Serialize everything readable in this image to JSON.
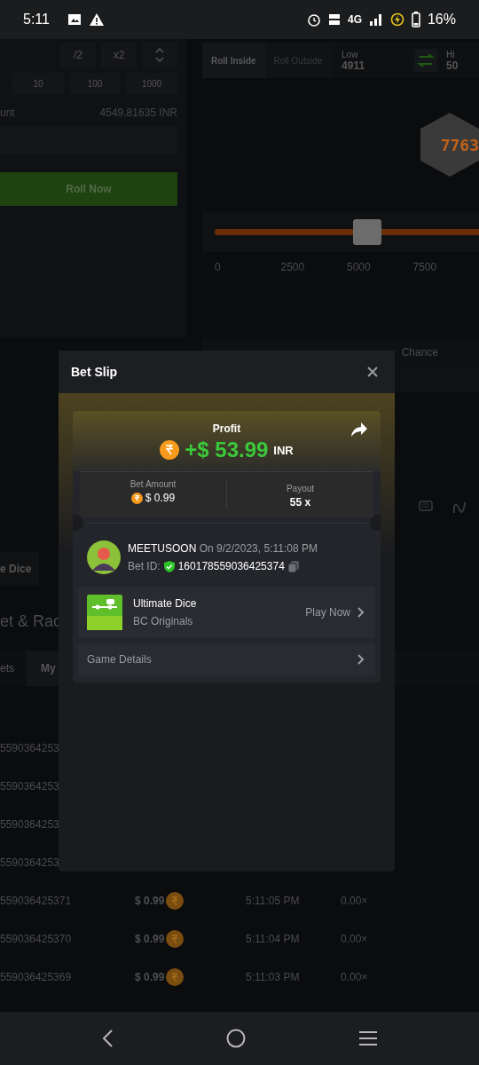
{
  "status_bar": {
    "time": "5:11",
    "network": "4G",
    "battery": "16%"
  },
  "bet_controls": {
    "half": "/2",
    "double": "x2",
    "presets": [
      "10",
      "100",
      "1000"
    ],
    "amount_label": "unt",
    "balance": "4549.81635 INR",
    "roll_button": "Roll Now"
  },
  "roll_panel": {
    "modes": [
      {
        "label": "Roll Inside",
        "selected": true
      },
      {
        "label": "Roll Outside",
        "selected": false
      }
    ],
    "low_label": "Low",
    "low_value": "4911",
    "high_label": "Hi",
    "high_value": "50",
    "result": "7763",
    "slider": {
      "level": 0.49
    },
    "scale": [
      "0",
      "2500",
      "5000",
      "7500"
    ],
    "chance_label": "Chance"
  },
  "lower": {
    "game_chip": "e Dice",
    "section_title": "et & Rac",
    "tabs": [
      {
        "label": "ets",
        "selected": false
      },
      {
        "label": "My",
        "selected": true
      }
    ],
    "rows": [
      {
        "bet_id": "5590364253"
      },
      {
        "bet_id": "5590364253"
      },
      {
        "bet_id": "5590364253"
      },
      {
        "bet_id": "5590364253"
      },
      {
        "bet_id": "559036425371",
        "amount": "$ 0.99",
        "time": "5:11:05 PM",
        "payout": "0.00×"
      },
      {
        "bet_id": "559036425370",
        "amount": "$ 0.99",
        "time": "5:11:04 PM",
        "payout": "0.00×"
      },
      {
        "bet_id": "559036425369",
        "amount": "$ 0.99",
        "time": "5:11:03 PM",
        "payout": "0.00×"
      }
    ]
  },
  "bet_slip": {
    "title": "Bet Slip",
    "profit_label": "Profit",
    "profit": "+$ 53.99",
    "currency": "INR",
    "bet_amount_label": "Bet Amount",
    "bet_amount": "$ 0.99",
    "payout_label": "Payout",
    "payout": "55 x",
    "user": "MEETUSOON",
    "date": "On 9/2/2023, 5:11:08 PM",
    "bet_id_label": "Bet ID:",
    "bet_id": "160178559036425374",
    "game": {
      "name": "Ultimate Dice",
      "provider": "BC Originals",
      "action": "Play Now"
    },
    "details": "Game Details"
  }
}
